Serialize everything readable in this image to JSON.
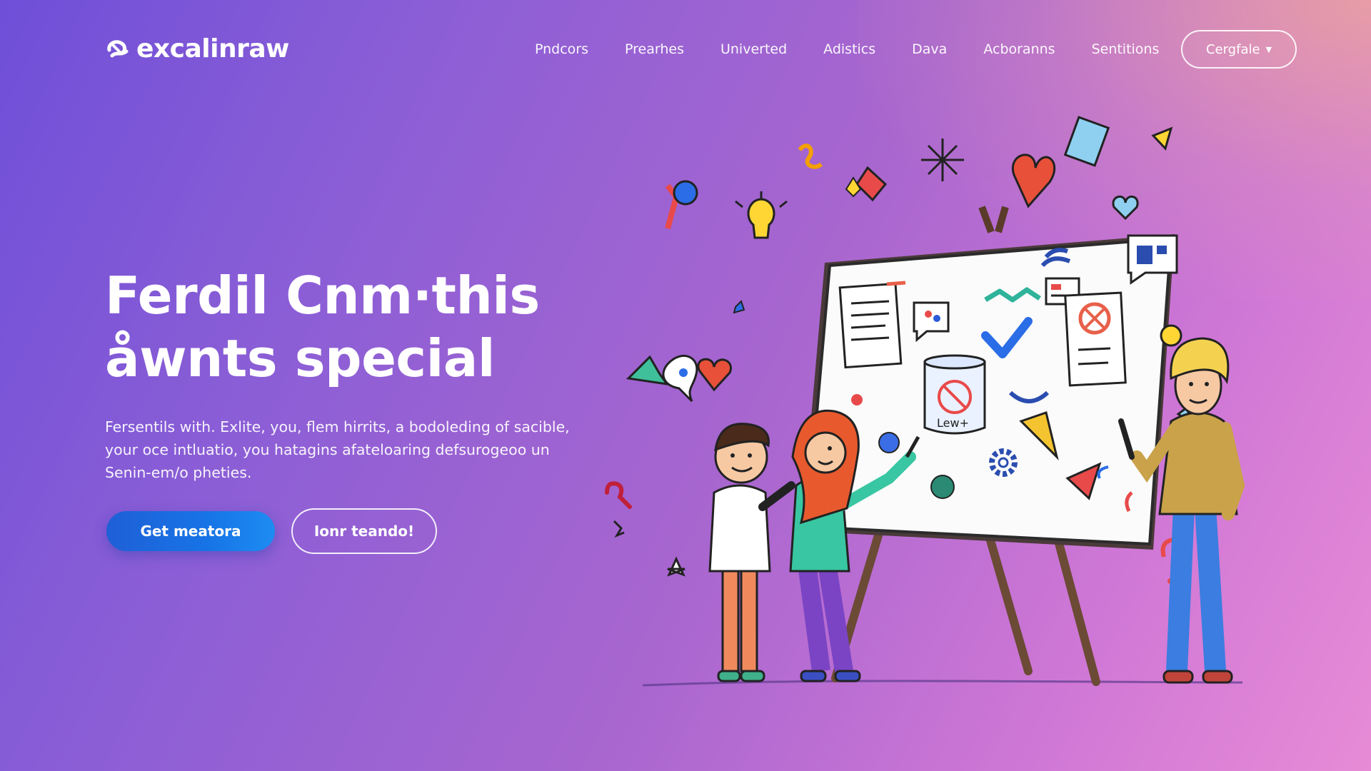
{
  "brand": {
    "name": "excalinraw"
  },
  "nav": {
    "links": [
      "Pndcors",
      "Prearhes",
      "Univerted",
      "Adistics",
      "Dava",
      "Acboranns",
      "Sentitions"
    ],
    "cta_label": "Cergfale"
  },
  "hero": {
    "title_lines": [
      "Ferdil Cnm·this",
      "åwnts special"
    ],
    "description_lines": [
      "Fersentils with. Exlite, you, flem hirrits, a bodoleding of sacible,",
      "your oce intluatio, you hatagins afateloaring defsurogeoo un",
      "Senin-em/o pheties."
    ],
    "primary_button": "Get meatora",
    "secondary_button": "Ionr teando!"
  },
  "illustration": {
    "board_label": "Lew+"
  },
  "colors": {
    "background_start": "#6f4fd8",
    "background_end": "#e78bd6",
    "primary_button": "#1774e6"
  },
  "icons": [
    "excalidraw-logo-icon",
    "chevron-down-icon"
  ]
}
